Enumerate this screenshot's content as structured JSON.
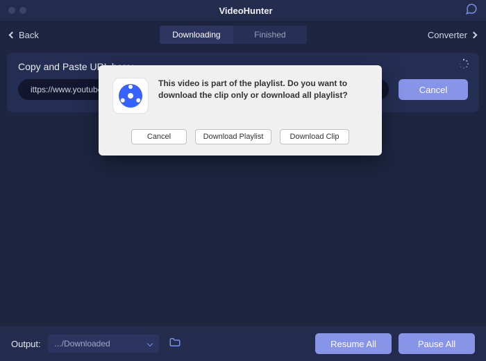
{
  "titlebar": {
    "title": "VideoHunter"
  },
  "nav": {
    "back_label": "Back",
    "tabs": {
      "downloading": "Downloading",
      "finished": "Finished"
    },
    "converter_label": "Converter"
  },
  "url_card": {
    "label": "Copy and Paste URL here:",
    "input_value": "ittps://www.youtube",
    "cancel_label": "Cancel"
  },
  "modal": {
    "message": "This video is part of the playlist. Do you want to download the clip only or download all playlist?",
    "cancel": "Cancel",
    "download_playlist": "Download Playlist",
    "download_clip": "Download Clip"
  },
  "footer": {
    "output_label": "Output:",
    "output_path": ".../Downloaded",
    "resume_all": "Resume All",
    "pause_all": "Pause All"
  },
  "colors": {
    "accent": "#8794e8",
    "bg": "#1d2541"
  }
}
